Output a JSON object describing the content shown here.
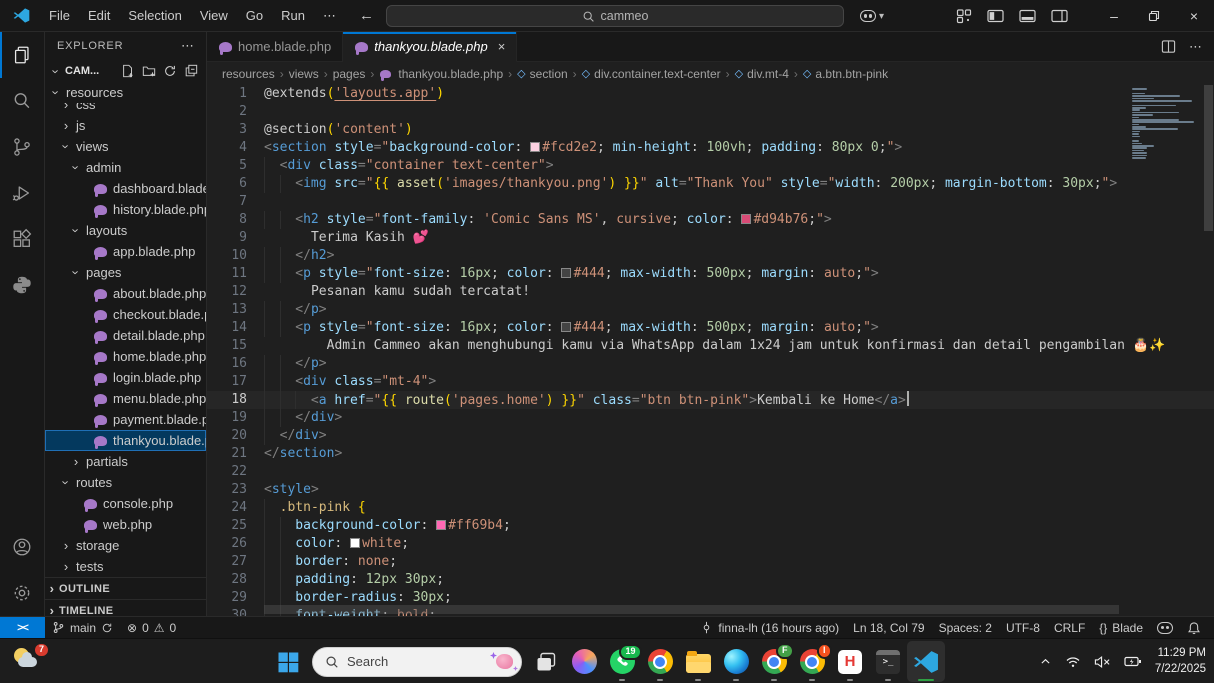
{
  "window": {
    "menus": [
      "File",
      "Edit",
      "Selection",
      "View",
      "Go",
      "Run",
      "⋯"
    ],
    "back_arrow": "←",
    "forward_arrow": "→",
    "search_value": "cammeo",
    "controls": {
      "minimize": "–",
      "close": "×"
    }
  },
  "activity_bar": {
    "items": [
      "explorer",
      "search",
      "source-control",
      "run-debug",
      "extensions",
      "python"
    ],
    "bottom": [
      "account",
      "settings"
    ]
  },
  "explorer": {
    "title": "EXPLORER",
    "more": "⋯",
    "project": "CAM...",
    "tree": [
      {
        "label": "resources",
        "kind": "folder",
        "state": "open",
        "level": 0
      },
      {
        "label": "css",
        "kind": "folder",
        "state": "closed",
        "level": 1,
        "clipped": true
      },
      {
        "label": "js",
        "kind": "folder",
        "state": "closed",
        "level": 1
      },
      {
        "label": "views",
        "kind": "folder",
        "state": "open",
        "level": 1
      },
      {
        "label": "admin",
        "kind": "folder",
        "state": "open",
        "level": 2
      },
      {
        "label": "dashboard.blade....",
        "kind": "file",
        "level": 3
      },
      {
        "label": "history.blade.php",
        "kind": "file",
        "level": 3
      },
      {
        "label": "layouts",
        "kind": "folder",
        "state": "open",
        "level": 2
      },
      {
        "label": "app.blade.php",
        "kind": "file",
        "level": 3
      },
      {
        "label": "pages",
        "kind": "folder",
        "state": "open",
        "level": 2
      },
      {
        "label": "about.blade.php",
        "kind": "file",
        "level": 3
      },
      {
        "label": "checkout.blade.p...",
        "kind": "file",
        "level": 3
      },
      {
        "label": "detail.blade.php",
        "kind": "file",
        "level": 3
      },
      {
        "label": "home.blade.php",
        "kind": "file",
        "level": 3
      },
      {
        "label": "login.blade.php",
        "kind": "file",
        "level": 3
      },
      {
        "label": "menu.blade.php",
        "kind": "file",
        "level": 3
      },
      {
        "label": "payment.blade.php",
        "kind": "file",
        "level": 3
      },
      {
        "label": "thankyou.blade.p...",
        "kind": "file",
        "level": 3,
        "selected": true
      },
      {
        "label": "partials",
        "kind": "folder",
        "state": "closed",
        "level": 2
      },
      {
        "label": "routes",
        "kind": "folder",
        "state": "open",
        "level": 1
      },
      {
        "label": "console.php",
        "kind": "file",
        "level": 2
      },
      {
        "label": "web.php",
        "kind": "file",
        "level": 2
      },
      {
        "label": "storage",
        "kind": "folder",
        "state": "closed",
        "level": 1
      },
      {
        "label": "tests",
        "kind": "folder",
        "state": "closed",
        "level": 1
      }
    ],
    "sections": [
      "OUTLINE",
      "TIMELINE"
    ]
  },
  "tabs": [
    {
      "label": "home.blade.php",
      "active": false
    },
    {
      "label": "thankyou.blade.php",
      "active": true,
      "close": "×"
    }
  ],
  "breadcrumbs": [
    {
      "label": "resources"
    },
    {
      "label": "views"
    },
    {
      "label": "pages"
    },
    {
      "label": "thankyou.blade.php",
      "icon": "blade"
    },
    {
      "label": "section",
      "icon": "symbol"
    },
    {
      "label": "div.container.text-center",
      "icon": "symbol"
    },
    {
      "label": "div.mt-4",
      "icon": "symbol"
    },
    {
      "label": "a.btn.btn-pink",
      "icon": "symbol"
    }
  ],
  "editor": {
    "active_line": 18,
    "code_lines": [
      [
        [
          "d",
          "@extends"
        ],
        [
          "b",
          "("
        ],
        [
          "su",
          "'layouts.app'"
        ],
        [
          "b",
          ")"
        ]
      ],
      [],
      [
        [
          "d",
          "@section"
        ],
        [
          "b",
          "("
        ],
        [
          "s",
          "'content'"
        ],
        [
          "b",
          ")"
        ]
      ],
      [
        [
          "p",
          "<"
        ],
        [
          "t",
          "section"
        ],
        [
          "d",
          " "
        ],
        [
          "a",
          "style"
        ],
        [
          "p",
          "="
        ],
        [
          "s",
          "\""
        ],
        [
          "a",
          "background-color"
        ],
        [
          "d",
          ": "
        ],
        [
          "w",
          "#fcd2e2"
        ],
        [
          "s",
          "#fcd2e2"
        ],
        [
          "d",
          "; "
        ],
        [
          "a",
          "min-height"
        ],
        [
          "d",
          ": "
        ],
        [
          "n",
          "100vh"
        ],
        [
          "d",
          "; "
        ],
        [
          "a",
          "padding"
        ],
        [
          "d",
          ": "
        ],
        [
          "n",
          "80px 0"
        ],
        [
          "d",
          ";"
        ],
        [
          "s",
          "\""
        ],
        [
          "p",
          ">"
        ]
      ],
      [
        [
          "d",
          "  "
        ],
        [
          "p",
          "<"
        ],
        [
          "t",
          "div"
        ],
        [
          "d",
          " "
        ],
        [
          "a",
          "class"
        ],
        [
          "p",
          "="
        ],
        [
          "s",
          "\"container text-center\""
        ],
        [
          "p",
          ">"
        ]
      ],
      [
        [
          "d",
          "    "
        ],
        [
          "p",
          "<"
        ],
        [
          "t",
          "img"
        ],
        [
          "d",
          " "
        ],
        [
          "a",
          "src"
        ],
        [
          "p",
          "="
        ],
        [
          "s",
          "\""
        ],
        [
          "b",
          "{{ "
        ],
        [
          "f",
          "asset"
        ],
        [
          "b",
          "("
        ],
        [
          "s",
          "'images/thankyou.png'"
        ],
        [
          "b",
          ")"
        ],
        [
          "b",
          " }}"
        ],
        [
          "s",
          "\""
        ],
        [
          "d",
          " "
        ],
        [
          "a",
          "alt"
        ],
        [
          "p",
          "="
        ],
        [
          "s",
          "\"Thank You\""
        ],
        [
          "d",
          " "
        ],
        [
          "a",
          "style"
        ],
        [
          "p",
          "="
        ],
        [
          "s",
          "\""
        ],
        [
          "a",
          "width"
        ],
        [
          "d",
          ": "
        ],
        [
          "n",
          "200px"
        ],
        [
          "d",
          "; "
        ],
        [
          "a",
          "margin-bottom"
        ],
        [
          "d",
          ": "
        ],
        [
          "n",
          "30px"
        ],
        [
          "d",
          ";"
        ],
        [
          "s",
          "\""
        ],
        [
          "p",
          ">"
        ]
      ],
      [],
      [
        [
          "d",
          "    "
        ],
        [
          "p",
          "<"
        ],
        [
          "t",
          "h2"
        ],
        [
          "d",
          " "
        ],
        [
          "a",
          "style"
        ],
        [
          "p",
          "="
        ],
        [
          "s",
          "\""
        ],
        [
          "a",
          "font-family"
        ],
        [
          "d",
          ": "
        ],
        [
          "s",
          "'Comic Sans MS'"
        ],
        [
          "d",
          ", "
        ],
        [
          "s",
          "cursive"
        ],
        [
          "d",
          "; "
        ],
        [
          "a",
          "color"
        ],
        [
          "d",
          ": "
        ],
        [
          "w",
          "#d94b76"
        ],
        [
          "s",
          "#d94b76"
        ],
        [
          "d",
          ";"
        ],
        [
          "s",
          "\""
        ],
        [
          "p",
          ">"
        ]
      ],
      [
        [
          "d",
          "      Terima Kasih "
        ],
        [
          "e",
          "💕"
        ]
      ],
      [
        [
          "d",
          "    "
        ],
        [
          "p",
          "</"
        ],
        [
          "t",
          "h2"
        ],
        [
          "p",
          ">"
        ]
      ],
      [
        [
          "d",
          "    "
        ],
        [
          "p",
          "<"
        ],
        [
          "t",
          "p"
        ],
        [
          "d",
          " "
        ],
        [
          "a",
          "style"
        ],
        [
          "p",
          "="
        ],
        [
          "s",
          "\""
        ],
        [
          "a",
          "font-size"
        ],
        [
          "d",
          ": "
        ],
        [
          "n",
          "16px"
        ],
        [
          "d",
          "; "
        ],
        [
          "a",
          "color"
        ],
        [
          "d",
          ": "
        ],
        [
          "w",
          "#444444"
        ],
        [
          "s",
          "#444"
        ],
        [
          "d",
          "; "
        ],
        [
          "a",
          "max-width"
        ],
        [
          "d",
          ": "
        ],
        [
          "n",
          "500px"
        ],
        [
          "d",
          "; "
        ],
        [
          "a",
          "margin"
        ],
        [
          "d",
          ": "
        ],
        [
          "s",
          "auto"
        ],
        [
          "d",
          ";"
        ],
        [
          "s",
          "\""
        ],
        [
          "p",
          ">"
        ]
      ],
      [
        [
          "d",
          "      Pesanan kamu sudah tercatat!"
        ]
      ],
      [
        [
          "d",
          "    "
        ],
        [
          "p",
          "</"
        ],
        [
          "t",
          "p"
        ],
        [
          "p",
          ">"
        ]
      ],
      [
        [
          "d",
          "    "
        ],
        [
          "p",
          "<"
        ],
        [
          "t",
          "p"
        ],
        [
          "d",
          " "
        ],
        [
          "a",
          "style"
        ],
        [
          "p",
          "="
        ],
        [
          "s",
          "\""
        ],
        [
          "a",
          "font-size"
        ],
        [
          "d",
          ": "
        ],
        [
          "n",
          "16px"
        ],
        [
          "d",
          "; "
        ],
        [
          "a",
          "color"
        ],
        [
          "d",
          ": "
        ],
        [
          "w",
          "#444444"
        ],
        [
          "s",
          "#444"
        ],
        [
          "d",
          "; "
        ],
        [
          "a",
          "max-width"
        ],
        [
          "d",
          ": "
        ],
        [
          "n",
          "500px"
        ],
        [
          "d",
          "; "
        ],
        [
          "a",
          "margin"
        ],
        [
          "d",
          ": "
        ],
        [
          "s",
          "auto"
        ],
        [
          "d",
          ";"
        ],
        [
          "s",
          "\""
        ],
        [
          "p",
          ">"
        ]
      ],
      [
        [
          "d",
          "        Admin Cammeo akan menghubungi kamu via WhatsApp dalam 1x24 jam untuk konfirmasi dan detail pengambilan "
        ],
        [
          "e",
          "🎂✨"
        ]
      ],
      [
        [
          "d",
          "    "
        ],
        [
          "p",
          "</"
        ],
        [
          "t",
          "p"
        ],
        [
          "p",
          ">"
        ]
      ],
      [
        [
          "d",
          "    "
        ],
        [
          "p",
          "<"
        ],
        [
          "t",
          "div"
        ],
        [
          "d",
          " "
        ],
        [
          "a",
          "class"
        ],
        [
          "p",
          "="
        ],
        [
          "s",
          "\"mt-4\""
        ],
        [
          "p",
          ">"
        ]
      ],
      [
        [
          "d",
          "      "
        ],
        [
          "p",
          "<"
        ],
        [
          "t",
          "a"
        ],
        [
          "d",
          " "
        ],
        [
          "a",
          "href"
        ],
        [
          "p",
          "="
        ],
        [
          "s",
          "\""
        ],
        [
          "b",
          "{{ "
        ],
        [
          "f",
          "route"
        ],
        [
          "b",
          "("
        ],
        [
          "s",
          "'pages.home'"
        ],
        [
          "b",
          ")"
        ],
        [
          "b",
          " }}"
        ],
        [
          "s",
          "\""
        ],
        [
          "d",
          " "
        ],
        [
          "a",
          "class"
        ],
        [
          "p",
          "="
        ],
        [
          "s",
          "\"btn btn-pink\""
        ],
        [
          "p",
          ">"
        ],
        [
          "d",
          "Kembali ke Home"
        ],
        [
          "p",
          "</"
        ],
        [
          "t",
          "a"
        ],
        [
          "p",
          ">"
        ]
      ],
      [
        [
          "d",
          "    "
        ],
        [
          "p",
          "</"
        ],
        [
          "t",
          "div"
        ],
        [
          "p",
          ">"
        ]
      ],
      [
        [
          "d",
          "  "
        ],
        [
          "p",
          "</"
        ],
        [
          "t",
          "div"
        ],
        [
          "p",
          ">"
        ]
      ],
      [
        [
          "p",
          "</"
        ],
        [
          "t",
          "section"
        ],
        [
          "p",
          ">"
        ]
      ],
      [],
      [
        [
          "p",
          "<"
        ],
        [
          "t",
          "style"
        ],
        [
          "p",
          ">"
        ]
      ],
      [
        [
          "d",
          "  "
        ],
        [
          "y",
          ".btn-pink"
        ],
        [
          "d",
          " "
        ],
        [
          "b",
          "{"
        ]
      ],
      [
        [
          "d",
          "    "
        ],
        [
          "a",
          "background-color"
        ],
        [
          "d",
          ": "
        ],
        [
          "w",
          "#ff69b4"
        ],
        [
          "s",
          "#ff69b4"
        ],
        [
          "d",
          ";"
        ]
      ],
      [
        [
          "d",
          "    "
        ],
        [
          "a",
          "color"
        ],
        [
          "d",
          ": "
        ],
        [
          "w",
          "#ffffff"
        ],
        [
          "s",
          "white"
        ],
        [
          "d",
          ";"
        ]
      ],
      [
        [
          "d",
          "    "
        ],
        [
          "a",
          "border"
        ],
        [
          "d",
          ": "
        ],
        [
          "s",
          "none"
        ],
        [
          "d",
          ";"
        ]
      ],
      [
        [
          "d",
          "    "
        ],
        [
          "a",
          "padding"
        ],
        [
          "d",
          ": "
        ],
        [
          "n",
          "12px 30px"
        ],
        [
          "d",
          ";"
        ]
      ],
      [
        [
          "d",
          "    "
        ],
        [
          "a",
          "border-radius"
        ],
        [
          "d",
          ": "
        ],
        [
          "n",
          "30px"
        ],
        [
          "d",
          ";"
        ]
      ],
      [
        [
          "d",
          "    "
        ],
        [
          "a",
          "font-weight"
        ],
        [
          "d",
          ": "
        ],
        [
          "s",
          "bold"
        ],
        [
          "d",
          ";"
        ]
      ]
    ]
  },
  "status_bar": {
    "remote": "><",
    "branch": "main",
    "errors": "0",
    "warnings": "0",
    "error_glyph": "⊗",
    "warning_glyph": "⚠",
    "commit": "finna-lh (16 hours ago)",
    "position": "Ln 18, Col 79",
    "spaces": "Spaces: 2",
    "encoding": "UTF-8",
    "eol": "CRLF",
    "language_prefix": "{}",
    "language": "Blade"
  },
  "taskbar": {
    "weather_badge": "7",
    "search_label": "Search",
    "whatsapp_badge": "19",
    "chrome_badge_f": "F",
    "chrome_badge_i": "I",
    "h_app_letter": "H",
    "terminal_glyph": ">_",
    "time": "11:29 PM",
    "date": "7/22/2025"
  },
  "colors": {
    "accent_blue": "#0078d4",
    "selection_blue": "#04395e",
    "swatch_section_bg": "#fcd2e2",
    "swatch_heading": "#d94b76",
    "swatch_text": "#444444",
    "swatch_btn_pink": "#ff69b4",
    "taskbar_active_indicator": "#2ea043"
  }
}
